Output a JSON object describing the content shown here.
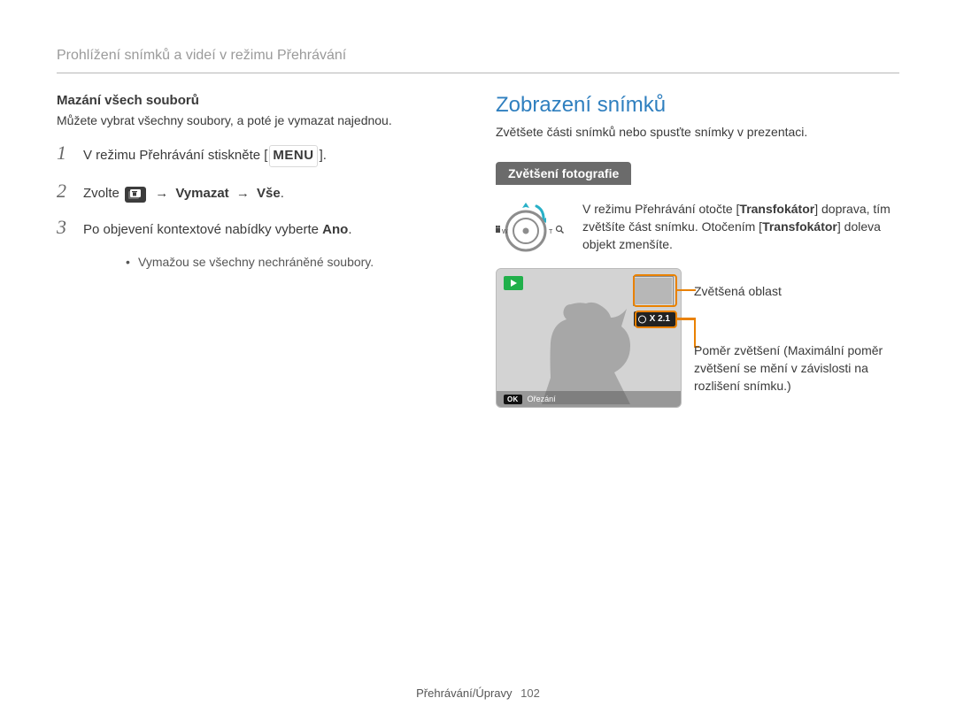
{
  "header": {
    "title": "Prohlížení snímků a videí v režimu Přehrávání"
  },
  "left": {
    "subhead": "Mazání všech souborů",
    "intro": "Můžete vybrat všechny soubory, a poté je vymazat najednou.",
    "steps": [
      {
        "n": "1",
        "pre": "V režimu Přehrávání stiskněte [",
        "menu": "MENU",
        "post": "]."
      },
      {
        "n": "2",
        "pre": "Zvolte ",
        "arrow": "→",
        "b1": "Vymazat",
        "b2": "Vše",
        "post": "."
      },
      {
        "n": "3",
        "pre": "Po objevení kontextové nabídky vyberte ",
        "b1": "Ano",
        "post": "."
      }
    ],
    "sublist": [
      "Vymažou se všechny nechráněné soubory."
    ]
  },
  "right": {
    "title": "Zobrazení snímků",
    "intro": "Zvětšete části snímků nebo spusťte snímky v prezentaci.",
    "tab": "Zvětšení fotografie",
    "zoom": {
      "left_tick": "W",
      "right_tick": "T",
      "text_pre": "V režimu Přehrávání otočte [",
      "b1": "Transfokátor",
      "text_mid": "] doprava, tím zvětšíte část snímku. Otočením [",
      "b2": "Transfokátor",
      "text_post": "] doleva objekt zmenšíte."
    },
    "preview": {
      "zoom_badge": "X 2.1",
      "ok": "OK",
      "crop": "Ořezání"
    },
    "callouts": {
      "c1": "Zvětšená oblast",
      "c2": "Poměr zvětšení (Maximální poměr zvětšení se mění v závislosti na rozlišení snímku.)"
    }
  },
  "footer": {
    "section": "Přehrávání/Úpravy",
    "page": "102"
  }
}
